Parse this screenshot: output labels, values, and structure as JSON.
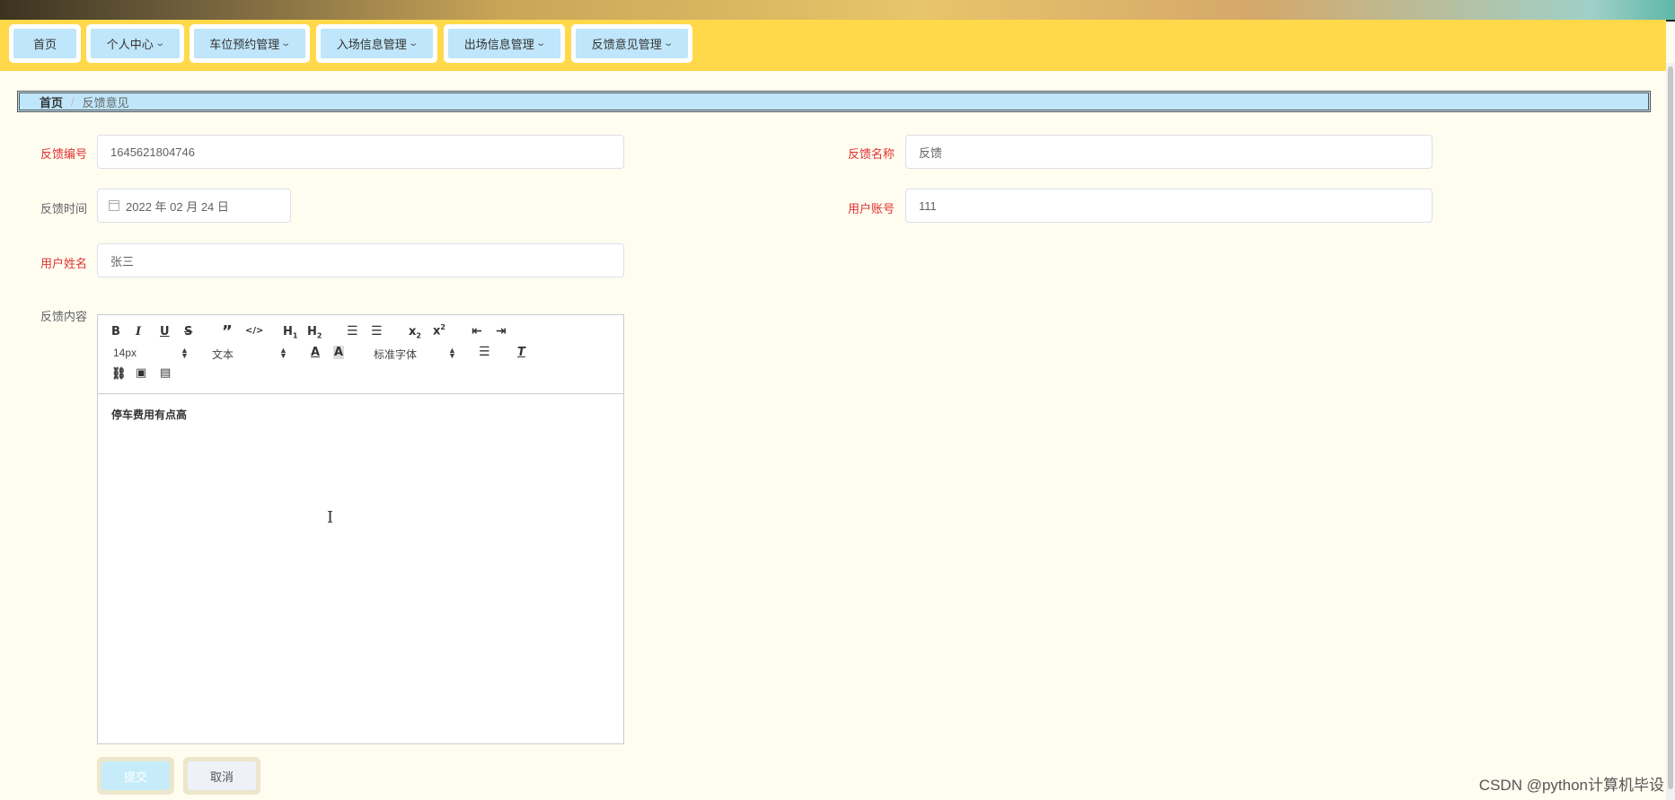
{
  "nav": {
    "items": [
      {
        "label": "首页",
        "dropdown": false
      },
      {
        "label": "个人中心",
        "dropdown": true
      },
      {
        "label": "车位预约管理",
        "dropdown": true
      },
      {
        "label": "入场信息管理",
        "dropdown": true
      },
      {
        "label": "出场信息管理",
        "dropdown": true
      },
      {
        "label": "反馈意见管理",
        "dropdown": true
      }
    ]
  },
  "breadcrumb": {
    "home": "首页",
    "separator": "/",
    "current": "反馈意见"
  },
  "form": {
    "feedback_no": {
      "label": "反馈编号",
      "value": "1645621804746",
      "required": true
    },
    "feedback_name": {
      "label": "反馈名称",
      "value": "反馈",
      "required": true
    },
    "feedback_time": {
      "label": "反馈时间",
      "value": "2022 年 02 月 24 日",
      "required": false
    },
    "user_account": {
      "label": "用户账号",
      "value": "111",
      "required": true
    },
    "user_name": {
      "label": "用户姓名",
      "value": "张三",
      "required": true
    },
    "feedback_content": {
      "label": "反馈内容",
      "value": "停车费用有点高",
      "required": false
    }
  },
  "editor": {
    "size": "14px",
    "header": "文本",
    "font": "标准字体",
    "buttons": [
      "bold",
      "italic",
      "underline",
      "strike",
      "blockquote",
      "code-block",
      "h1",
      "h2",
      "ordered-list",
      "bullet-list",
      "subscript",
      "superscript",
      "outdent",
      "indent",
      "color",
      "background",
      "align",
      "clean",
      "link",
      "image",
      "video"
    ]
  },
  "actions": {
    "submit": "提交",
    "cancel": "取消"
  },
  "watermark": "CSDN @python计算机毕设",
  "colors": {
    "nav_bg": "#ffd94a",
    "nav_item_bg": "#bfe6fa",
    "page_bg": "#fffdf0",
    "required_label": "#e03030"
  }
}
